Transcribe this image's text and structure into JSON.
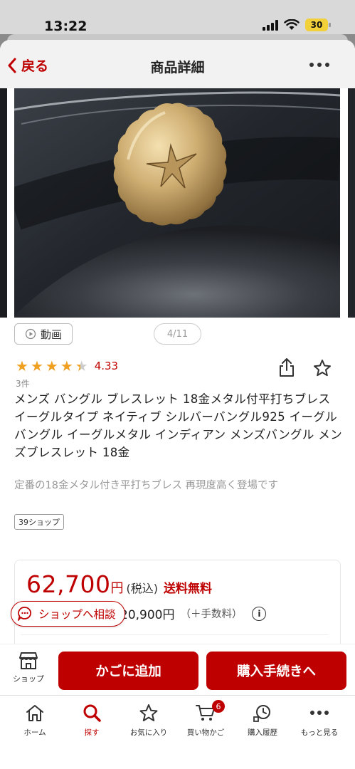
{
  "status_bar": {
    "time": "13:22",
    "battery": "30"
  },
  "nav": {
    "back_label": "戻る",
    "title": "商品詳細"
  },
  "gallery": {
    "video_label": "動画",
    "page_indicator": "4/11"
  },
  "product": {
    "rating": 4.33,
    "rating_text": "4.33",
    "review_count": "3件",
    "title": "メンズ バングル ブレスレット 18金メタル付平打ちブレス イーグルタイプ ネイティブ シルバーバングル925 イーグルバングル イーグルメタル インディアン メンズバングル メンズブレスレット 18金",
    "subtitle": "定番の18金メタル付き平打ちブレス 再現度高く登場です",
    "shop_badge": "39ショップ"
  },
  "price": {
    "amount": "62,700",
    "yen": "円",
    "tax": "(税込)",
    "shipping": "送料無料",
    "sub_amount": "20,900円",
    "sub_fee": "（＋手数料）"
  },
  "consult_label": "ショップへ相談",
  "actions": {
    "shop_label": "ショップ",
    "cart_label": "かごに追加",
    "buy_label": "購入手続きへ"
  },
  "tabs": [
    {
      "label": "ホーム",
      "icon": "home-icon"
    },
    {
      "label": "探す",
      "icon": "search-icon"
    },
    {
      "label": "お気に入り",
      "icon": "star-icon"
    },
    {
      "label": "買い物かご",
      "icon": "cart-icon",
      "badge": "6"
    },
    {
      "label": "購入履歴",
      "icon": "history-icon"
    },
    {
      "label": "もっと見る",
      "icon": "more-icon"
    }
  ],
  "colors": {
    "accent": "#bf0000",
    "star": "#f0a020"
  }
}
